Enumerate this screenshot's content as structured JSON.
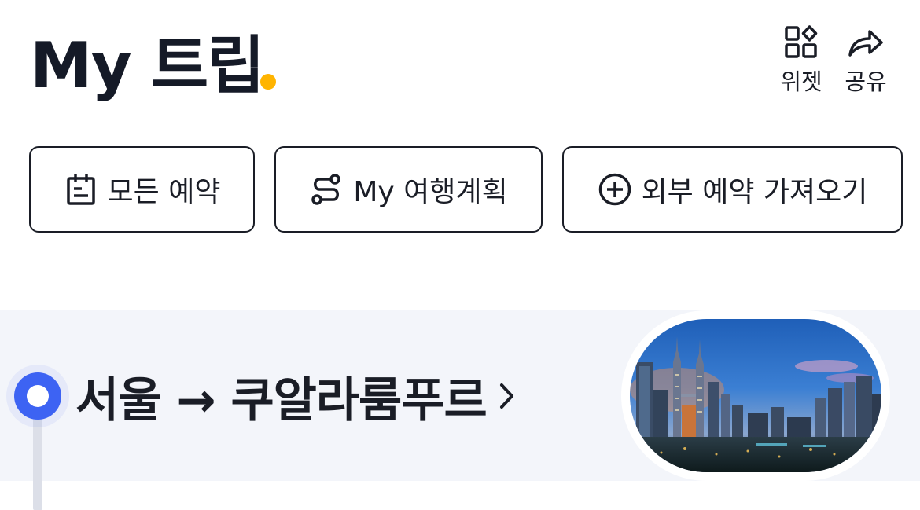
{
  "header": {
    "title": "My 트립",
    "accent_color": "#ffb400",
    "actions": [
      {
        "label": "위젯",
        "icon": "widget-icon"
      },
      {
        "label": "공유",
        "icon": "share-icon"
      }
    ]
  },
  "quick_actions": [
    {
      "label": "모든 예약",
      "icon": "clipboard-icon"
    },
    {
      "label": "My 여행계획",
      "icon": "route-icon"
    },
    {
      "label": "외부 예약 가져오기",
      "icon": "plus-circle-icon"
    }
  ],
  "trip": {
    "route": "서울 → 쿠알라룸푸르",
    "timeline_color": "#3d63f3",
    "image": "kuala-lumpur-skyline"
  }
}
